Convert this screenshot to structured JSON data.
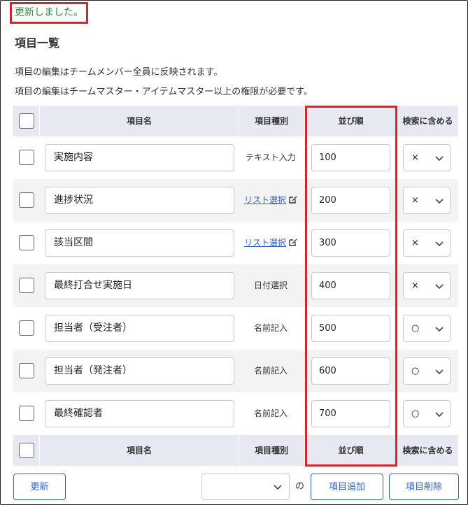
{
  "flash_message": "更新しました。",
  "page_title": "項目一覧",
  "descriptions": [
    "項目の編集はチームメンバー全員に反映されます。",
    "項目の編集はチームマスター・アイテムマスター以上の権限が必要です。"
  ],
  "table": {
    "headers": {
      "name": "項目名",
      "kind": "項目種別",
      "order": "並び順",
      "search": "検索に含める"
    },
    "rows": [
      {
        "name": "実施内容",
        "kind": "テキスト入力",
        "kind_is_link": false,
        "order": "100",
        "search": "×"
      },
      {
        "name": "進捗状況",
        "kind": "リスト選択",
        "kind_is_link": true,
        "order": "200",
        "search": "×"
      },
      {
        "name": "該当区間",
        "kind": "リスト選択",
        "kind_is_link": true,
        "order": "300",
        "search": "×"
      },
      {
        "name": "最終打合せ実施日",
        "kind": "日付選択",
        "kind_is_link": false,
        "order": "400",
        "search": "×"
      },
      {
        "name": "担当者（受注者）",
        "kind": "名前記入",
        "kind_is_link": false,
        "order": "500",
        "search": "○"
      },
      {
        "name": "担当者（発注者）",
        "kind": "名前記入",
        "kind_is_link": false,
        "order": "600",
        "search": "○"
      },
      {
        "name": "最終確認者",
        "kind": "名前記入",
        "kind_is_link": false,
        "order": "700",
        "search": "○"
      }
    ]
  },
  "footer": {
    "update_label": "更新",
    "no_label": "の",
    "add_label": "項目追加",
    "delete_label": "項目削除"
  },
  "colors": {
    "accent": "#2b5fd0",
    "highlight": "#d9242b",
    "success": "#2e8b3d",
    "header_bg": "#e6e9f1",
    "row_alt": "#f3f3f3"
  }
}
